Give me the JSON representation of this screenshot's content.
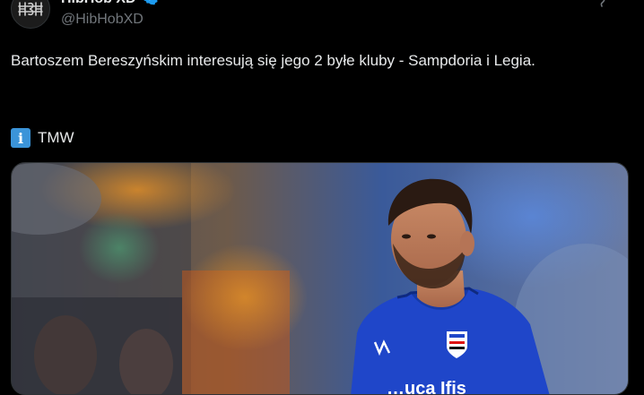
{
  "tweet": {
    "author": {
      "display_name": "HibHob XD",
      "handle": "@HibHobXD",
      "avatar_icon": "avatar-logo-icon",
      "verified_icon": "verified-badge-icon"
    },
    "more_icon": "more-options-icon",
    "text": "Bartoszem Bereszyńskim interesują się jego 2 byłe kluby - Sampdoria i Legia.",
    "source_icon": "info-icon",
    "source": "TMW",
    "media": {
      "jersey_sponsor_text": "…uca Ifis"
    }
  },
  "colors": {
    "background": "#000000",
    "text": "#e7e9ea",
    "muted": "#71767b",
    "verified": "#1d9bf0",
    "jersey": "#1f46c9"
  }
}
